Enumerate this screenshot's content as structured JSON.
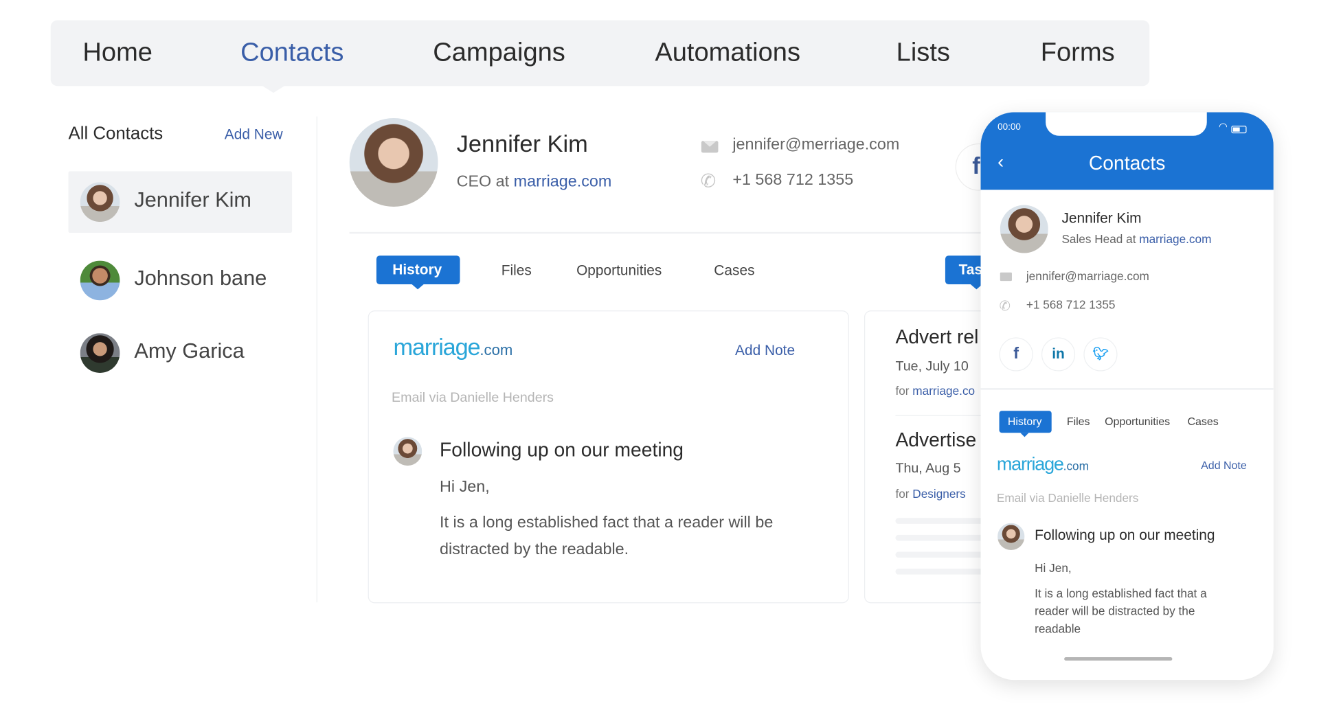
{
  "nav": {
    "items": [
      {
        "label": "Home",
        "active": false
      },
      {
        "label": "Contacts",
        "active": true
      },
      {
        "label": "Campaigns",
        "active": false
      },
      {
        "label": "Automations",
        "active": false
      },
      {
        "label": "Lists",
        "active": false
      },
      {
        "label": "Forms",
        "active": false
      }
    ]
  },
  "sidebar": {
    "title": "All Contacts",
    "add_new": "Add New",
    "contacts": [
      {
        "name": "Jennifer Kim",
        "selected": true
      },
      {
        "name": "Johnson bane",
        "selected": false
      },
      {
        "name": "Amy Garica",
        "selected": false
      }
    ]
  },
  "profile": {
    "name": "Jennifer Kim",
    "role_prefix": "CEO at ",
    "company": "marriage.com",
    "email": "jennifer@merriage.com",
    "phone": "+1 568 712 1355",
    "social_icon": "facebook-icon"
  },
  "tabs": {
    "items": [
      "History",
      "Files",
      "Opportunities",
      "Cases"
    ],
    "active": "History",
    "tasks_label": "Tas"
  },
  "note_card": {
    "logo_main": "marriage",
    "logo_suffix": ".com",
    "add_note": "Add Note",
    "via": "Email via Danielle Henders",
    "subject": "Following up on our meeting",
    "greeting": "Hi Jen,",
    "body": "It is a long established fact that a reader will be distracted by the readable."
  },
  "events": [
    {
      "title": "Advert rel",
      "date": "Tue, July 10",
      "for_prefix": "for ",
      "for_link": "marriage.co"
    },
    {
      "title": "Advertise",
      "date": "Thu, Aug 5",
      "for_prefix": "for ",
      "for_link": "Designers"
    }
  ],
  "phone": {
    "status_time": "00:00",
    "title": "Contacts",
    "contact": {
      "name": "Jennifer Kim",
      "role_prefix": "Sales Head at ",
      "company": "marriage.com",
      "email": "jennifer@marriage.com",
      "phone": "+1 568 712 1355"
    },
    "social": [
      {
        "icon": "facebook-icon",
        "glyph": "f",
        "color": "#3b5998"
      },
      {
        "icon": "linkedin-icon",
        "glyph": "in",
        "color": "#0e76a8"
      },
      {
        "icon": "twitter-icon",
        "glyph": "🐦",
        "color": "#1da1f2"
      }
    ],
    "tabs": [
      "History",
      "Files",
      "Opportunities",
      "Cases"
    ],
    "note": {
      "logo_main": "marriage",
      "logo_suffix": ".com",
      "add_note": "Add Note",
      "via": "Email via Danielle Henders",
      "subject": "Following up on our meeting",
      "greeting": "Hi Jen,",
      "body": "It is a long established fact that a reader will be distracted by the readable"
    }
  },
  "colors": {
    "accent": "#1b73d3",
    "link": "#3a5ea8",
    "nav_bg": "#f2f3f5"
  }
}
